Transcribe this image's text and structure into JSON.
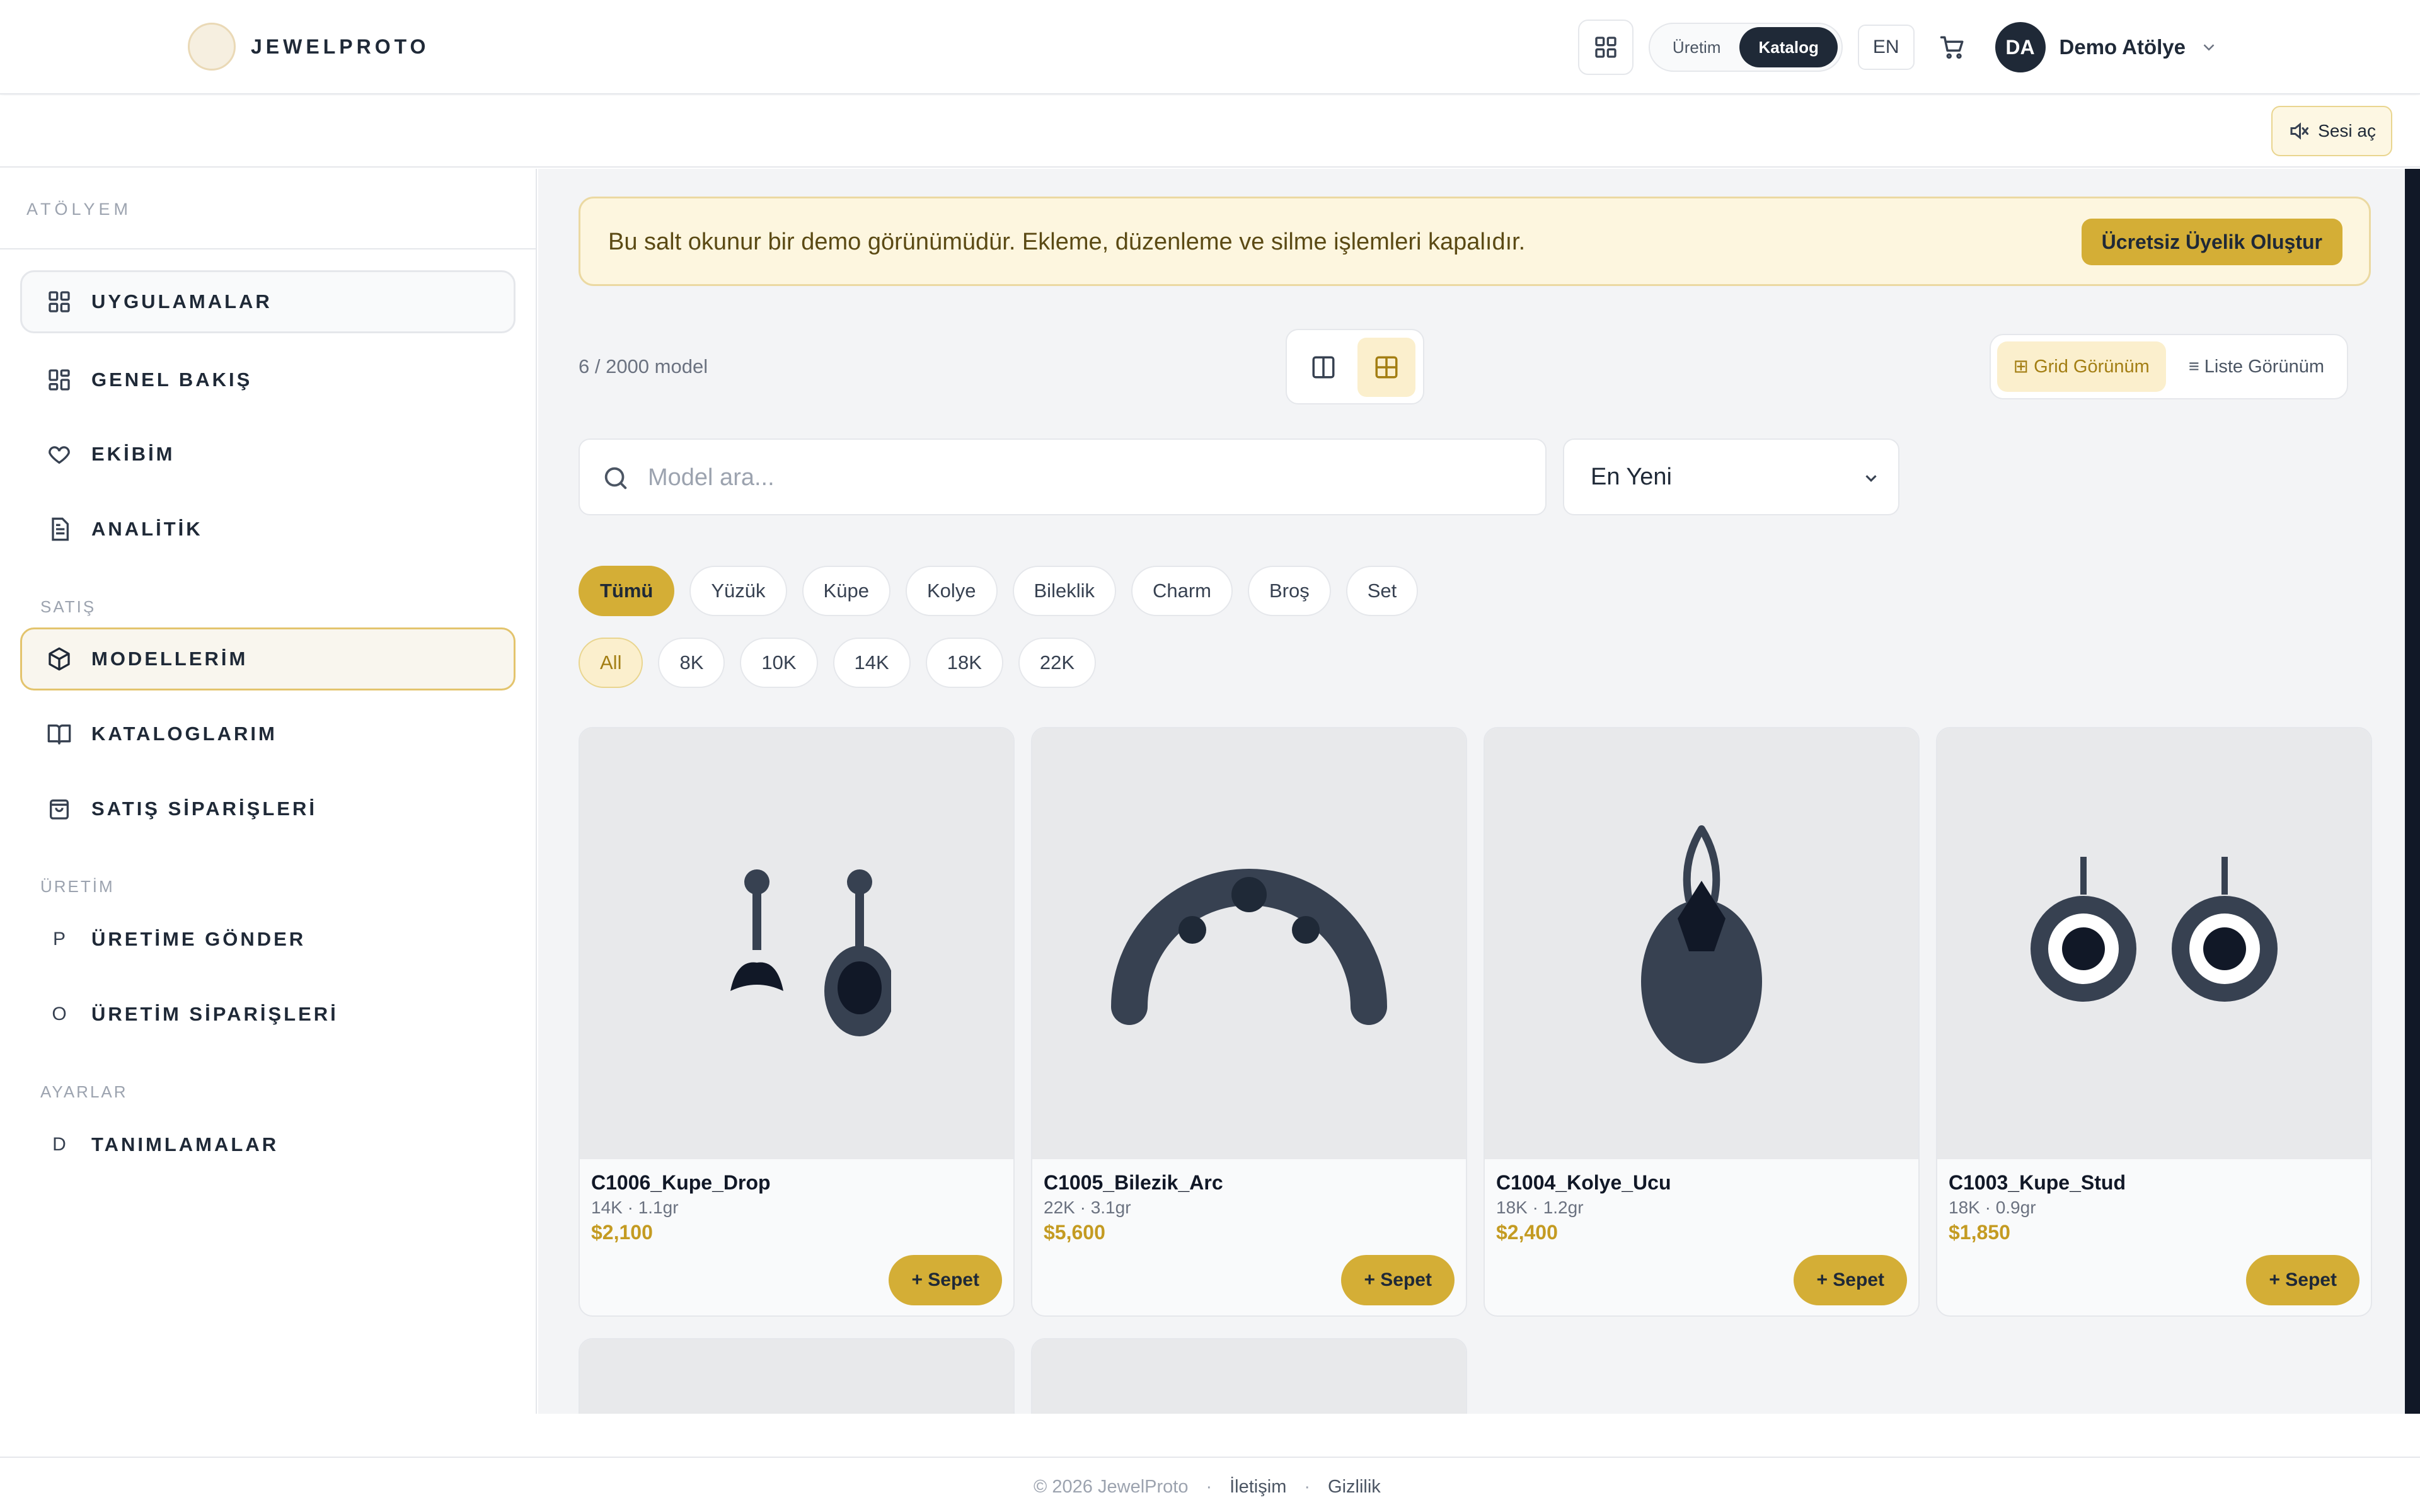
{
  "header": {
    "brand": "JEWELPROTO",
    "mode_options": [
      "Üretim",
      "Katalog"
    ],
    "mode_active": "Katalog",
    "language": "EN",
    "user_initials": "DA",
    "user_name": "Demo Atölye"
  },
  "subbar": {
    "sound_label": "Sesi aç"
  },
  "sidebar": {
    "heading": "ATÖLYEM",
    "items_top": [
      {
        "label": "UYGULAMALAR",
        "icon": "grid-icon"
      },
      {
        "label": "GENEL BAKIŞ",
        "icon": "dashboard-icon"
      },
      {
        "label": "EKİBİM",
        "icon": "heart-icon"
      },
      {
        "label": "ANALİTİK",
        "icon": "document-icon"
      }
    ],
    "section_sales": "SATIŞ",
    "items_sales": [
      {
        "label": "MODELLERİM",
        "icon": "cube-icon"
      },
      {
        "label": "KATALOGLARIM",
        "icon": "book-icon"
      },
      {
        "label": "SATIŞ SİPARİŞLERİ",
        "icon": "bag-icon"
      }
    ],
    "section_production": "ÜRETİM",
    "items_production": [
      {
        "label": "ÜRETİME GÖNDER",
        "glyph": "P"
      },
      {
        "label": "ÜRETİM SİPARİŞLERİ",
        "glyph": "O"
      }
    ],
    "section_settings": "AYARLAR",
    "items_settings": [
      {
        "label": "TANIMLAMALAR",
        "glyph": "D"
      }
    ]
  },
  "banner": {
    "text": "Bu salt okunur bir demo görünümüdür. Ekleme, düzenleme ve silme işlemleri kapalıdır.",
    "button": "Ücretsiz Üyelik Oluştur"
  },
  "toolbar": {
    "count": "6 / 2000 model",
    "grid_view": "Grid Görünüm",
    "list_view": "Liste Görünüm"
  },
  "search": {
    "placeholder": "Model ara..."
  },
  "sort": {
    "value": "En Yeni"
  },
  "categories": [
    "Tümü",
    "Yüzük",
    "Küpe",
    "Kolye",
    "Bileklik",
    "Charm",
    "Broş",
    "Set"
  ],
  "karats": [
    "All",
    "8K",
    "10K",
    "14K",
    "18K",
    "22K"
  ],
  "products": [
    {
      "name": "C1006_Kupe_Drop",
      "meta": "14K · 1.1gr",
      "price": "$2,100",
      "button": "+ Sepet",
      "image": "drop-earrings"
    },
    {
      "name": "C1005_Bilezik_Arc",
      "meta": "22K · 3.1gr",
      "price": "$5,600",
      "button": "+ Sepet",
      "image": "arc-bracelet"
    },
    {
      "name": "C1004_Kolye_Ucu",
      "meta": "18K · 1.2gr",
      "price": "$2,400",
      "button": "+ Sepet",
      "image": "pendant"
    },
    {
      "name": "C1003_Kupe_Stud",
      "meta": "18K · 0.9gr",
      "price": "$1,850",
      "button": "+ Sepet",
      "image": "stud-earrings"
    }
  ],
  "footer": {
    "copyright": "© 2026 JewelProto",
    "contact": "İletişim",
    "privacy": "Gizlilik",
    "separator": "·"
  },
  "colors": {
    "accent": "#d4ae36",
    "dark": "#1f2937",
    "banner_bg": "#fdf6df"
  }
}
